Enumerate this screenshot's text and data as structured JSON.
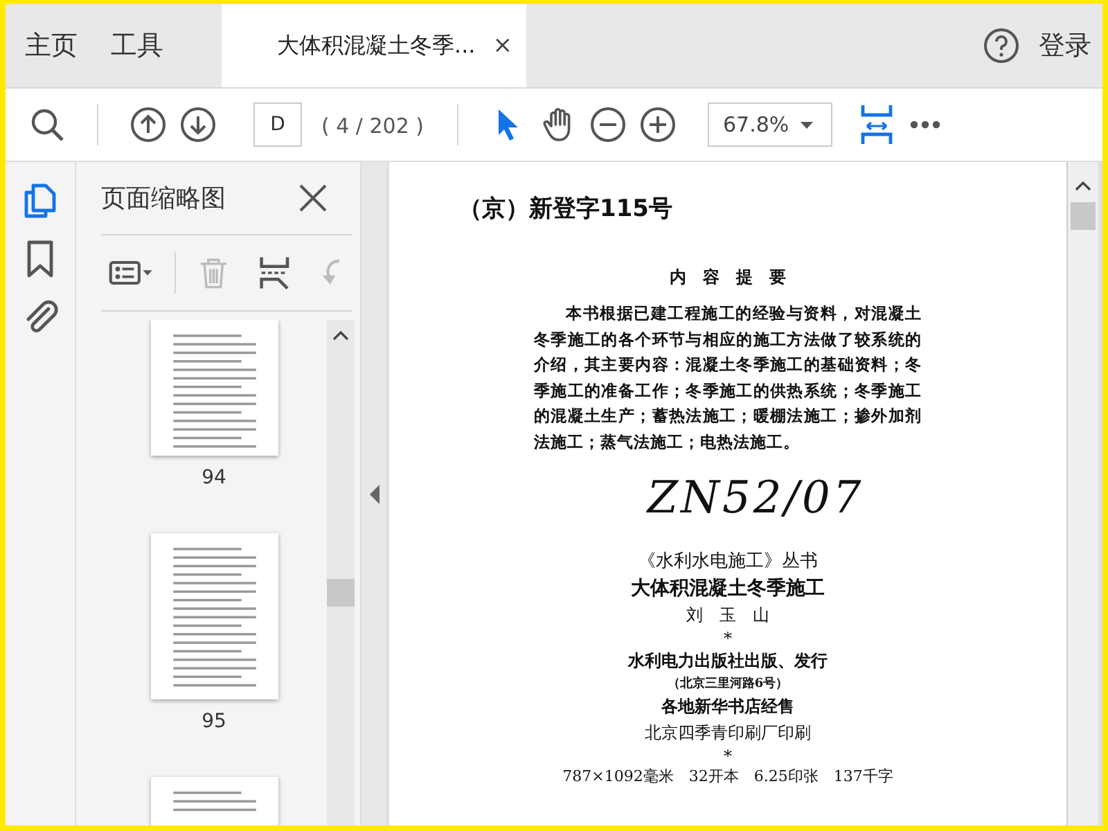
{
  "top_bar": {
    "menu": [
      {
        "label": "主页"
      },
      {
        "label": "工具"
      }
    ],
    "tabs": [
      {
        "label": "大体积混凝土冬季...",
        "close_glyph": "×",
        "selected": true
      }
    ],
    "sign_in": "登录"
  },
  "toolbar": {
    "page_field": {
      "value": "D"
    },
    "page_count": "( 4 / 202 )",
    "tools": [
      {
        "kind": "select",
        "selected": true
      },
      {
        "kind": "hand",
        "selected": false
      }
    ],
    "zoom": {
      "value": "67.8%"
    }
  },
  "side_rail": [
    {
      "kind": "pages",
      "selected": true
    },
    {
      "kind": "bookmarks",
      "selected": false
    },
    {
      "kind": "attachments",
      "selected": false
    }
  ],
  "thumbnail_panel": {
    "title": "页面缩略图",
    "tools": [
      {
        "kind": "options",
        "disabled": false
      },
      {
        "kind": "delete",
        "disabled": true
      },
      {
        "kind": "extract",
        "disabled": false
      },
      {
        "kind": "rotate",
        "disabled": true
      }
    ],
    "thumbnails": [
      {
        "label": "94",
        "cut": true
      },
      {
        "label": "95",
        "cut": false
      }
    ]
  },
  "document": {
    "lines": [
      {
        "kind": "registration",
        "text": "（京）新登字115号"
      },
      {
        "kind": "section-title",
        "text": "内　容　提　要"
      },
      {
        "kind": "paragraph",
        "text": "本书根据已建工程施工的经验与资料，对混凝土冬季施工的各个环节与相应的施工方法做了较系统的介绍，其主要内容：混凝土冬季施工的基础资料；冬季施工的准备工作；冬季施工的供热系统；冬季施工的混凝土生产；蓄热法施工；暖棚法施工；掺外加剂法施工；蒸气法施工；电热法施工。"
      },
      {
        "kind": "handwriting",
        "text": "ZN52/07"
      },
      {
        "kind": "series",
        "text": "《水利水电施工》丛书"
      },
      {
        "kind": "book-title",
        "text": "大体积混凝土冬季施工"
      },
      {
        "kind": "author",
        "text": "刘　玉　山"
      },
      {
        "kind": "separator",
        "text": "*"
      },
      {
        "kind": "publisher",
        "text": "水利电力出版社出版、发行"
      },
      {
        "kind": "address",
        "text": "（北京三里河路6号）"
      },
      {
        "kind": "publisher",
        "text": "各地新华书店经售"
      },
      {
        "kind": "author",
        "text": "北京四季青印刷厂印刷"
      },
      {
        "kind": "separator",
        "text": "*"
      },
      {
        "kind": "specs",
        "text": "787×1092毫米　32开本　6.25印张　137千字"
      }
    ]
  }
}
